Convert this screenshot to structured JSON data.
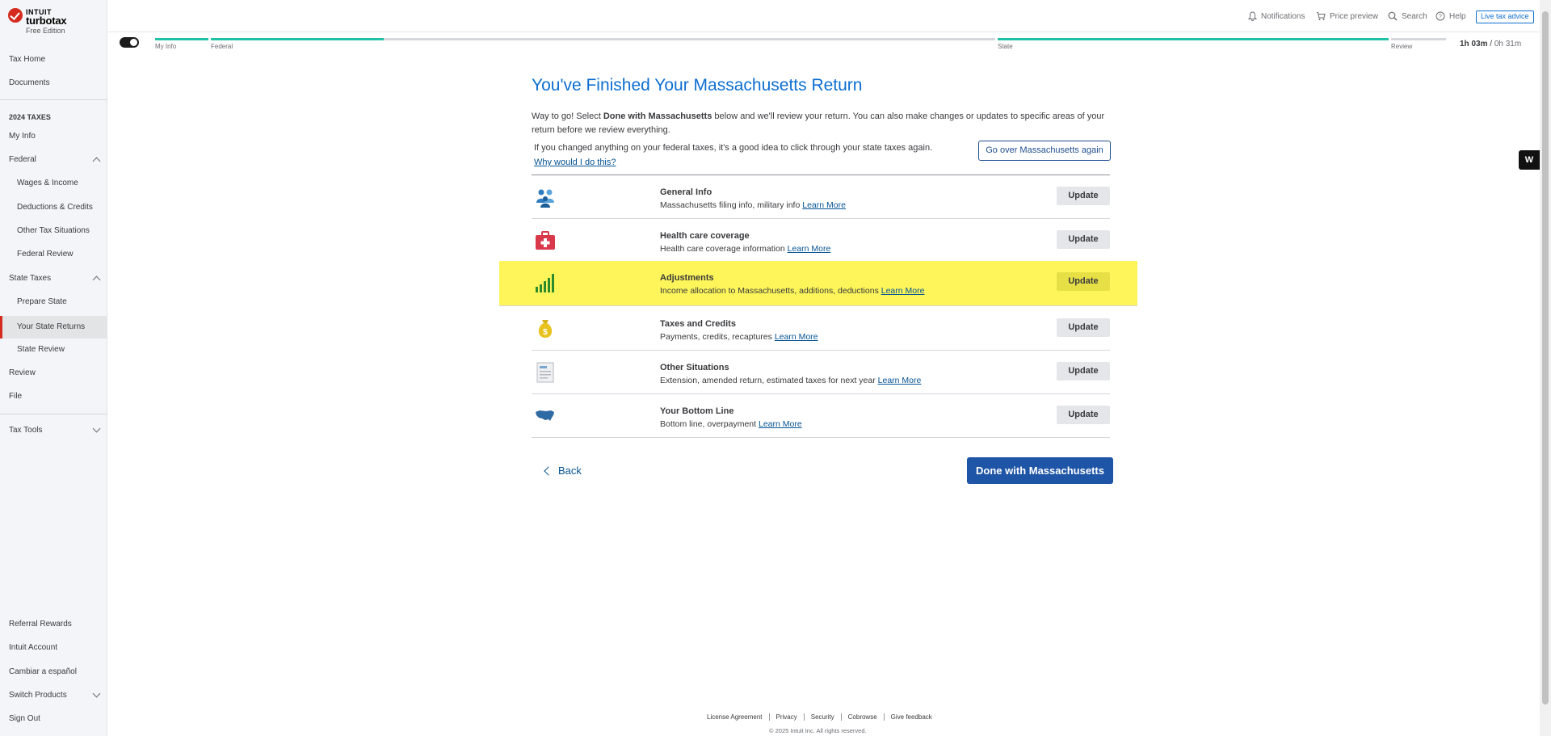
{
  "brand": {
    "intuit": "INTUIT",
    "name": "turbotax",
    "edition": "Free Edition"
  },
  "sidebar": {
    "tax_home": "Tax Home",
    "documents": "Documents",
    "section_heading": "2024 TAXES",
    "my_info": "My Info",
    "federal": "Federal",
    "wages": "Wages & Income",
    "deductions": "Deductions & Credits",
    "other_tax": "Other Tax Situations",
    "federal_review": "Federal Review",
    "state_taxes": "State Taxes",
    "prepare_state": "Prepare State",
    "your_state_returns": "Your State Returns",
    "state_review": "State Review",
    "review": "Review",
    "file": "File",
    "tax_tools": "Tax Tools",
    "referral": "Referral Rewards",
    "intuit_account": "Intuit Account",
    "espanol": "Cambiar a español",
    "switch_products": "Switch Products",
    "sign_out": "Sign Out"
  },
  "topbar": {
    "notifications": "Notifications",
    "price_preview": "Price preview",
    "search": "Search",
    "help": "Help",
    "live_advice": "Live tax advice"
  },
  "progress": {
    "steps": [
      "My Info",
      "Federal",
      "State",
      "Review"
    ],
    "federal_fill_pct": 22,
    "state_fill_pct": 100,
    "timer_main": "1h 03m",
    "timer_sep": " / ",
    "timer_secondary": "0h 31m"
  },
  "main": {
    "title": "You've Finished Your Massachusetts Return",
    "intro_pre": "Way to go! Select ",
    "intro_bold": "Done with Massachusetts",
    "intro_post": " below and we'll review your return. You can also make changes or updates to specific areas of your return before we review everything.",
    "notice": "If you changed anything on your federal taxes, it's a good idea to click through your state taxes again.",
    "why_link": "Why would I do this?",
    "again_button": "Go over Massachusetts again",
    "rows": [
      {
        "title": "General Info",
        "desc": "Massachusetts filing info, military info",
        "learn": "Learn More",
        "button": "Update"
      },
      {
        "title": "Health care coverage",
        "desc": "Health care coverage information",
        "learn": "Learn More",
        "button": "Update"
      },
      {
        "title": "Adjustments",
        "desc": "Income allocation to Massachusetts, additions, deductions",
        "learn": "Learn More",
        "button": "Update"
      },
      {
        "title": "Taxes and Credits",
        "desc": "Payments, credits, recaptures",
        "learn": "Learn More",
        "button": "Update"
      },
      {
        "title": "Other Situations",
        "desc": "Extension, amended return, estimated taxes for next year",
        "learn": "Learn More",
        "button": "Update"
      },
      {
        "title": "Your Bottom Line",
        "desc": "Bottom line, overpayment",
        "learn": "Learn More",
        "button": "Update"
      }
    ],
    "back": "Back",
    "done_button": "Done with Massachusetts"
  },
  "footer": {
    "links": [
      "License Agreement",
      "Privacy",
      "Security",
      "Cobrowse",
      "Give feedback"
    ],
    "copyright": "© 2025 Intuit Inc. All rights reserved."
  },
  "widget": {
    "label": "W"
  },
  "colors": {
    "accent": "#0d6ed1",
    "progress": "#21c1a5",
    "highlight": "#fdf559",
    "primary_button": "#1f55a6"
  }
}
